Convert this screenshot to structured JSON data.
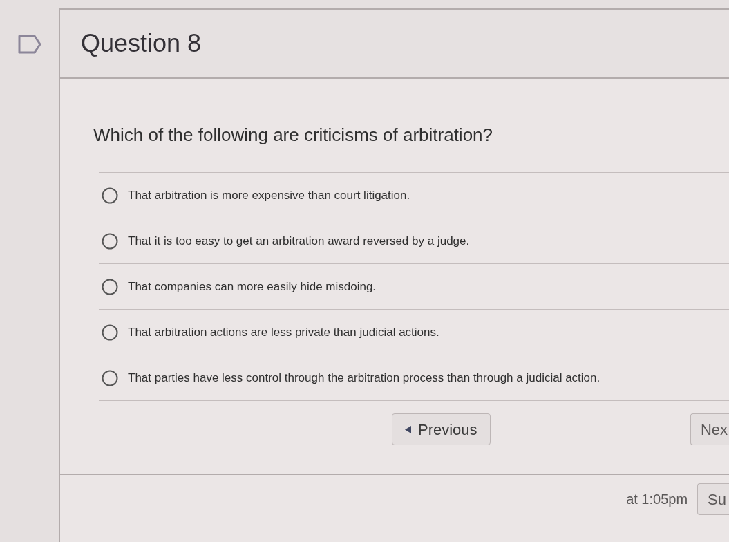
{
  "question": {
    "flagged": false,
    "title": "Question 8",
    "prompt": "Which of the following are criticisms of arbitration?",
    "options": [
      {
        "label": "That arbitration is more expensive than court litigation.",
        "selected": false
      },
      {
        "label": "That it is too easy to get an arbitration award reversed by a judge.",
        "selected": false
      },
      {
        "label": "That companies can more easily hide misdoing.",
        "selected": false
      },
      {
        "label": "That arbitration actions are less private than judicial actions.",
        "selected": false
      },
      {
        "label": "That parties have less control through the arbitration process than through a judicial action.",
        "selected": false
      }
    ]
  },
  "navigation": {
    "previous": "Previous",
    "next": "Nex"
  },
  "footer": {
    "saved_text": "at 1:05pm",
    "submit": "Su"
  }
}
